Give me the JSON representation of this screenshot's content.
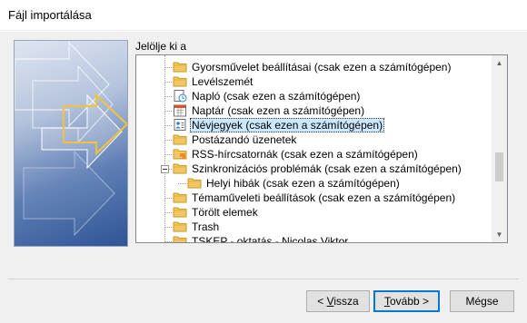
{
  "window": {
    "title": "Fájl importálása"
  },
  "prompt": "Jelölje ki a",
  "tree": {
    "items": [
      {
        "label": "Gyorsművelet beállításai (csak ezen a számítógépen)",
        "icon": "folder-icon",
        "level": 1,
        "expander": false,
        "selected": false
      },
      {
        "label": "Levélszemét",
        "icon": "folder-icon",
        "level": 1,
        "expander": false,
        "selected": false
      },
      {
        "label": "Napló (csak ezen a számítógépen)",
        "icon": "journal-icon",
        "level": 1,
        "expander": false,
        "selected": false
      },
      {
        "label": "Naptár (csak ezen a számítógépen)",
        "icon": "calendar-icon",
        "level": 1,
        "expander": false,
        "selected": false
      },
      {
        "label": "Névjegyek (csak ezen a számítógépen)",
        "icon": "contacts-icon",
        "level": 1,
        "expander": false,
        "selected": true
      },
      {
        "label": "Postázandó üzenetek",
        "icon": "folder-icon",
        "level": 1,
        "expander": false,
        "selected": false
      },
      {
        "label": "RSS-hírcsatornák (csak ezen a számítógépen)",
        "icon": "rss-folder-icon",
        "level": 1,
        "expander": false,
        "selected": false
      },
      {
        "label": "Szinkronizációs problémák (csak ezen a számítógépen)",
        "icon": "folder-icon",
        "level": 1,
        "expander": true,
        "selected": false
      },
      {
        "label": "Helyi hibák (csak ezen a számítógépen)",
        "icon": "folder-icon",
        "level": 2,
        "expander": false,
        "selected": false
      },
      {
        "label": "Témaműveleti beállítások (csak ezen a számítógépen)",
        "icon": "folder-icon",
        "level": 1,
        "expander": false,
        "selected": false
      },
      {
        "label": "Törölt elemek",
        "icon": "folder-icon",
        "level": 1,
        "expander": false,
        "selected": false
      },
      {
        "label": "Trash",
        "icon": "folder-icon",
        "level": 1,
        "expander": false,
        "selected": false
      },
      {
        "label": "TSKEP - oktatás - Nicolas Viktor",
        "icon": "folder-icon",
        "level": 1,
        "expander": false,
        "selected": false
      }
    ]
  },
  "buttons": {
    "back": {
      "before": "< ",
      "mnemonic": "V",
      "after": "issza"
    },
    "next": {
      "before": "",
      "mnemonic": "T",
      "after": "ovább >"
    },
    "cancel": {
      "label": "Mégse"
    }
  },
  "colors": {
    "accent": "#0078d7",
    "selection": "#cce8ff",
    "folder": "#e8b84a"
  }
}
